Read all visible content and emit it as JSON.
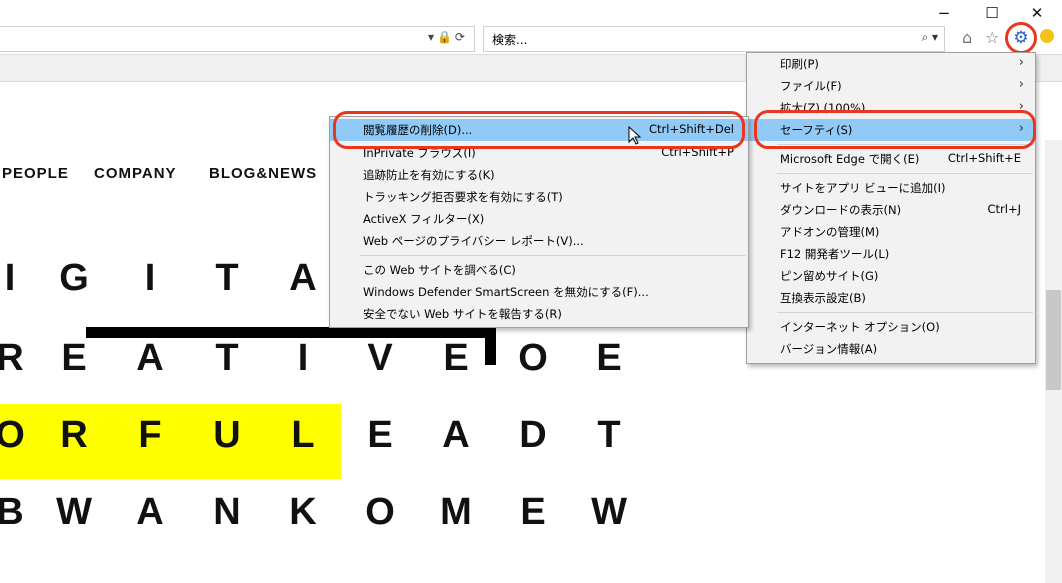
{
  "search": {
    "placeholder": "検索..."
  },
  "nav": {
    "items": [
      "PEOPLE",
      "COMPANY",
      "BLOG&NEWS"
    ]
  },
  "puzzle": {
    "rows": [
      {
        "letters": [
          "I",
          "G",
          "I",
          "T",
          "A"
        ]
      },
      {
        "letters": [
          "R",
          "E",
          "A",
          "T",
          "I",
          "V",
          "E",
          "O",
          "E"
        ]
      },
      {
        "letters": [
          "O",
          "R",
          "F",
          "U",
          "L",
          "E",
          "A",
          "D",
          "T"
        ]
      },
      {
        "letters": [
          "B",
          "W",
          "A",
          "N",
          "K",
          "O",
          "M",
          "E",
          "W"
        ]
      }
    ]
  },
  "main_menu": {
    "items": [
      {
        "label": "印刷(P)",
        "arrow": true
      },
      {
        "label": "ファイル(F)",
        "arrow": true
      },
      {
        "label": "拡大(Z) (100%)",
        "arrow": true
      },
      {
        "label": "セーフティ(S)",
        "arrow": true
      },
      {
        "label": "Microsoft Edge で開く(E)",
        "shortcut": "Ctrl+Shift+E"
      },
      {
        "label": "サイトをアプリ ビューに追加(I)"
      },
      {
        "label": "ダウンロードの表示(N)",
        "shortcut": "Ctrl+J"
      },
      {
        "label": "アドオンの管理(M)"
      },
      {
        "label": "F12 開発者ツール(L)"
      },
      {
        "label": "ピン留めサイト(G)"
      },
      {
        "label": "互換表示設定(B)"
      },
      {
        "label": "インターネット オプション(O)"
      },
      {
        "label": "バージョン情報(A)"
      }
    ]
  },
  "safety_menu": {
    "items": [
      {
        "label": "閲覧履歴の削除(D)...",
        "shortcut": "Ctrl+Shift+Del"
      },
      {
        "label": "InPrivate ブラウズ(I)",
        "shortcut": "Ctrl+Shift+P"
      },
      {
        "label": "追跡防止を有効にする(K)"
      },
      {
        "label": "トラッキング拒否要求を有効にする(T)"
      },
      {
        "label": "ActiveX フィルター(X)"
      },
      {
        "label": "Web ページのプライバシー レポート(V)..."
      },
      {
        "label": "この Web サイトを調べる(C)"
      },
      {
        "label": "Windows Defender SmartScreen を無効にする(F)..."
      },
      {
        "label": "安全でない Web サイトを報告する(R)"
      }
    ]
  },
  "icons": {
    "minimize": "−",
    "maximize": "☐",
    "close": "✕",
    "home": "⌂",
    "star": "☆",
    "gear": "⚙",
    "search": "⌕"
  },
  "colors": {
    "highlight": "#91c9f7",
    "annotation": "#e8361f",
    "gear": "#1a63c7",
    "puzzle_highlight": "#ffff00"
  }
}
